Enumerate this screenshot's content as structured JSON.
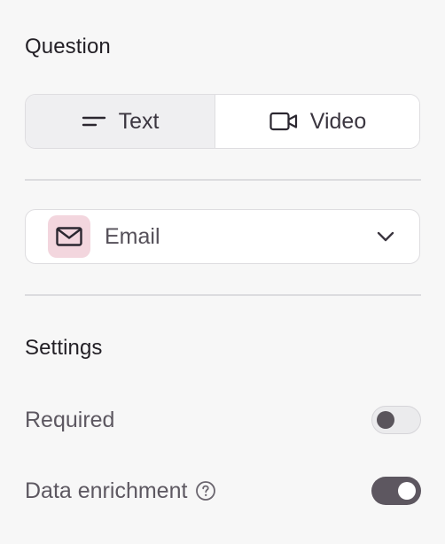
{
  "question": {
    "title": "Question",
    "modes": [
      {
        "label": "Text",
        "icon": "text-lines-icon",
        "active": true
      },
      {
        "label": "Video",
        "icon": "video-camera-icon",
        "active": false
      }
    ],
    "field_type": {
      "label": "Email",
      "icon": "envelope-icon",
      "badge_color": "#f3d6de"
    }
  },
  "settings": {
    "title": "Settings",
    "required": {
      "label": "Required",
      "enabled": false
    },
    "data_enrichment": {
      "label": "Data enrichment",
      "enabled": true,
      "help_icon": "question-circle-icon"
    }
  },
  "colors": {
    "background": "#f7f7f7",
    "toggle_on": "#5d5760",
    "toggle_off": "#ebebed"
  }
}
